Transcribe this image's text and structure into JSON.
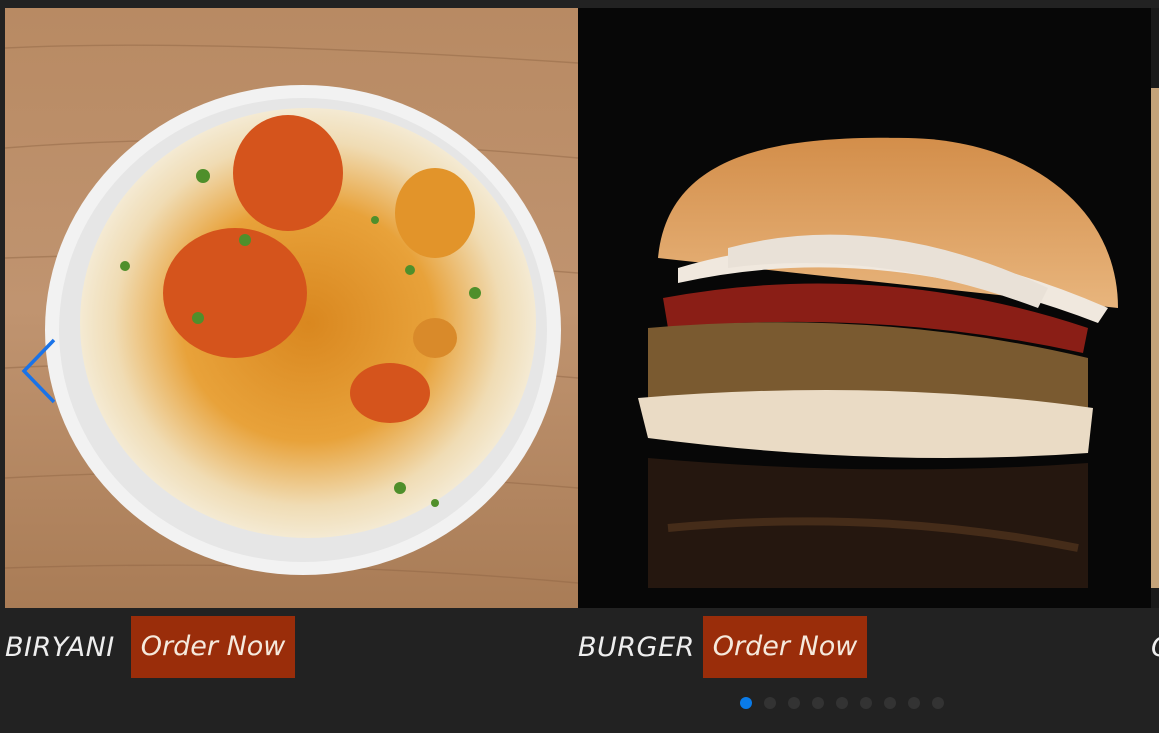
{
  "carousel": {
    "slides": [
      {
        "name": "BIRYANI",
        "button": "Order Now"
      },
      {
        "name": "BURGER",
        "button": "Order Now"
      },
      {
        "name": "C",
        "button": ""
      }
    ],
    "prev_icon": "chevron-left-icon",
    "pagination": {
      "total": 9,
      "active": 1
    },
    "colors": {
      "background": "#222222",
      "button": "#9a2d0a",
      "accent": "#0a7be8"
    }
  }
}
